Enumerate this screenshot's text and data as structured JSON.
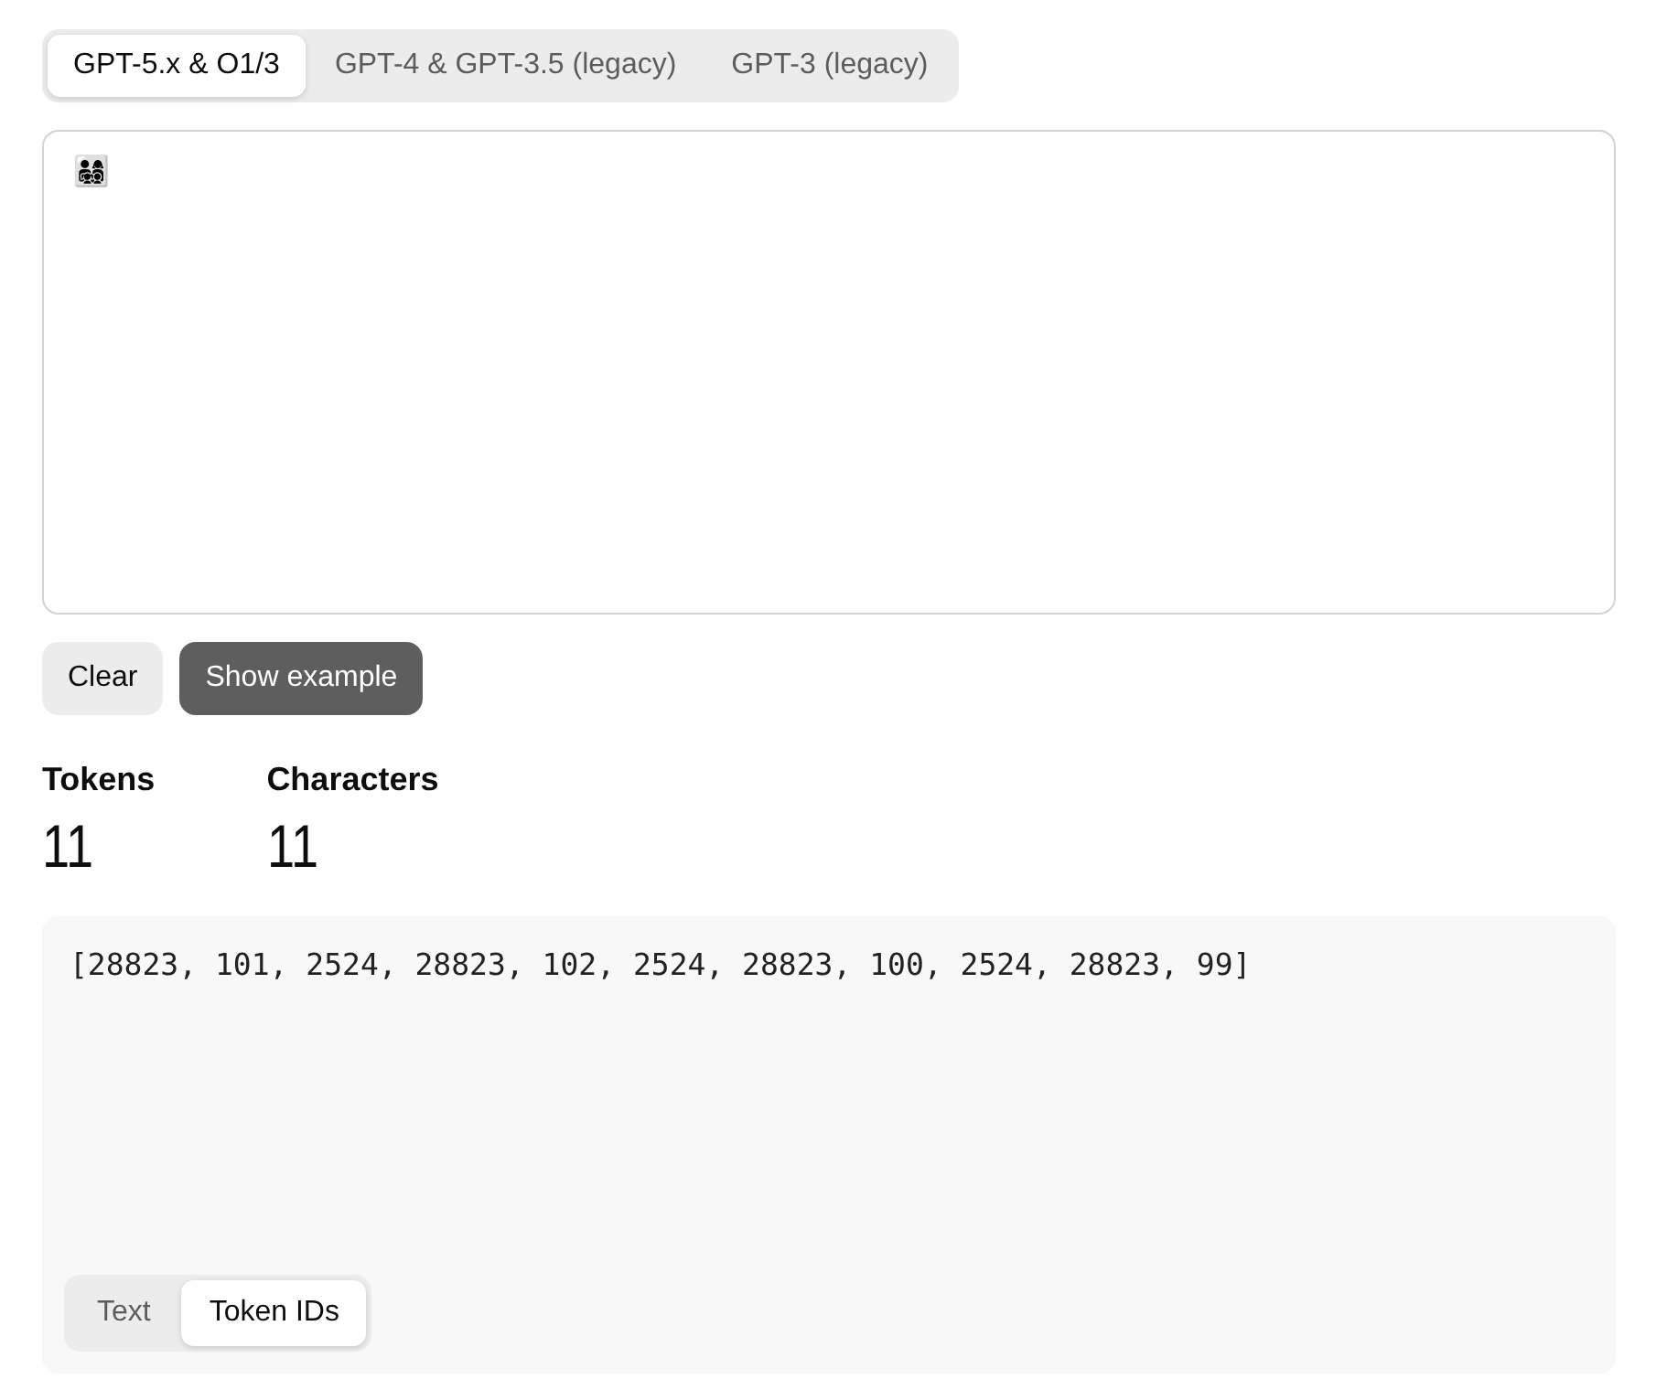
{
  "model_tabs": [
    {
      "label": "GPT-5.x & O1/3",
      "selected": true
    },
    {
      "label": "GPT-4 & GPT-3.5 (legacy)",
      "selected": false
    },
    {
      "label": "GPT-3 (legacy)",
      "selected": false
    }
  ],
  "input": {
    "value": "👨‍👩‍👧‍👦"
  },
  "buttons": [
    {
      "label": "Clear",
      "kind": "secondary"
    },
    {
      "label": "Show example",
      "kind": "primary"
    }
  ],
  "stats": [
    {
      "label": "Tokens",
      "value": "11"
    },
    {
      "label": "Characters",
      "value": "11"
    }
  ],
  "output": {
    "text": "[28823, 101, 2524, 28823, 102, 2524, 28823, 100, 2524, 28823, 99]",
    "view_tabs": [
      {
        "label": "Text",
        "selected": false
      },
      {
        "label": "Token IDs",
        "selected": true
      }
    ]
  }
}
